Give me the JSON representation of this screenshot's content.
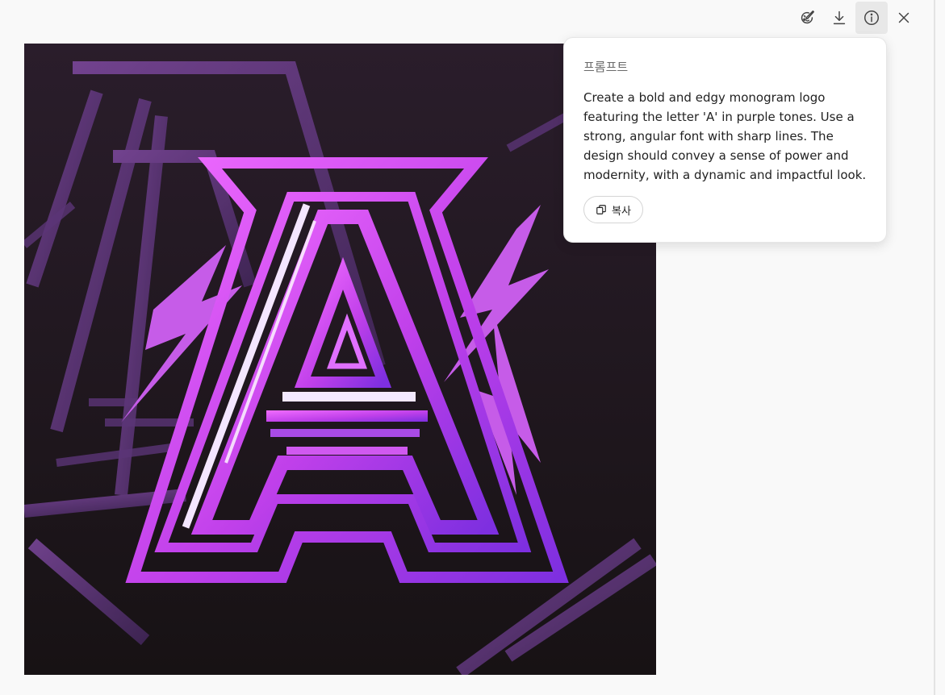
{
  "toolbar": {
    "icons": [
      "edit-image-icon",
      "download-icon",
      "info-icon",
      "close-icon"
    ],
    "active_icon": "info-icon",
    "icon_color": "#444444"
  },
  "image": {
    "subject": "purple angular letter A monogram logo",
    "accent_color": "#d94cf0",
    "background_color": "#1c1619"
  },
  "popover": {
    "title": "프롬프트",
    "prompt": "Create a bold and edgy monogram logo featuring the letter 'A' in purple tones. Use a strong, angular font with sharp lines. The design should convey a sense of power and modernity, with a dynamic and impactful look.",
    "copy_label": "복사",
    "copy_icon": "copy-icon"
  }
}
